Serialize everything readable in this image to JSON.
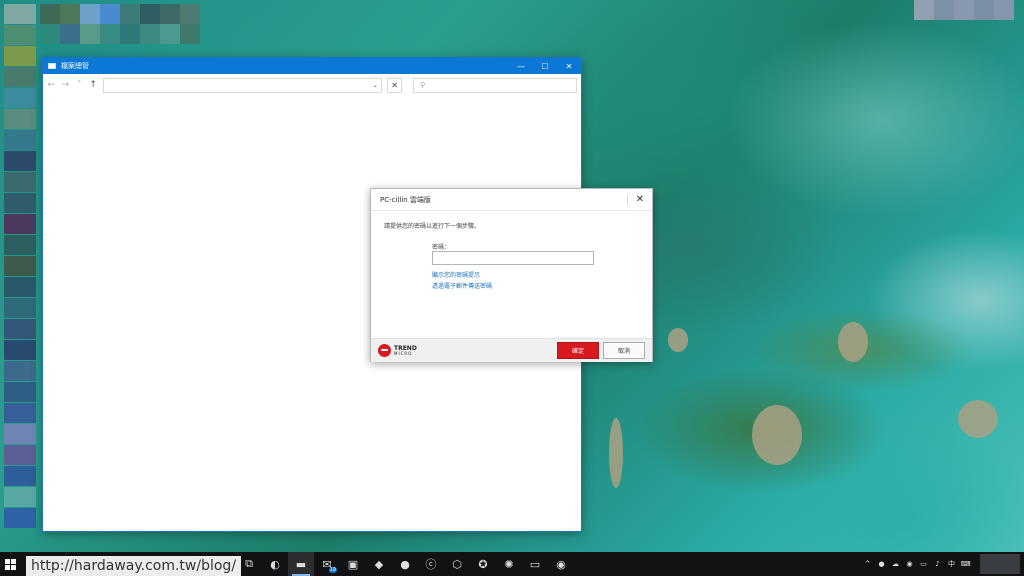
{
  "colors": {
    "accent_blue": "#0a78d4",
    "trend_red": "#d71920",
    "link_blue": "#1a6fbd",
    "taskbar": "#101214"
  },
  "explorer": {
    "title": "檔案總管",
    "controls": {
      "minimize": "—",
      "maximize": "☐",
      "close": "✕"
    },
    "nav": {
      "back": "←",
      "forward": "→",
      "recent": "˅",
      "up": "↑"
    },
    "address_dropdown": "⌄",
    "address_clear": "✕",
    "search_icon": "⚲"
  },
  "dialog": {
    "title": "PC-cillin 雲端版",
    "close": "✕",
    "prompt": "請提供您的密碼以進行下一個步驟。",
    "password_label": "密碼：",
    "password_value": "",
    "link_show_hint": "顯示您的密碼提示",
    "link_email_reset": "透過電子郵件傳送密碼",
    "ok_button": "確定",
    "cancel_button": "取消",
    "logo": {
      "word": "TREND",
      "sub": "MICRO"
    }
  },
  "watermark": "http://hardaway.com.tw/blog/",
  "taskbar": {
    "apps": [
      {
        "name": "task-view-icon",
        "glyph": "⧉"
      },
      {
        "name": "edge-icon",
        "glyph": "◐"
      },
      {
        "name": "file-explorer-icon",
        "glyph": "▬",
        "active": true
      },
      {
        "name": "mail-icon",
        "glyph": "✉",
        "badge": "19"
      },
      {
        "name": "store-icon",
        "glyph": "▣"
      },
      {
        "name": "app-purple-icon",
        "glyph": "◆"
      },
      {
        "name": "firefox-icon",
        "glyph": "●"
      },
      {
        "name": "app-c-icon",
        "glyph": "ⓒ"
      },
      {
        "name": "box-3d-icon",
        "glyph": "⬡"
      },
      {
        "name": "app-yellow-icon",
        "glyph": "✪"
      },
      {
        "name": "app-gear-icon",
        "glyph": "✺"
      },
      {
        "name": "monitor-icon",
        "glyph": "▭"
      },
      {
        "name": "trend-micro-icon",
        "glyph": "◉"
      }
    ],
    "tray": [
      {
        "name": "chevron-up-icon",
        "glyph": "^"
      },
      {
        "name": "tray-app-red-icon",
        "glyph": "●"
      },
      {
        "name": "tray-cloud-icon",
        "glyph": "☁"
      },
      {
        "name": "tray-trend-icon",
        "glyph": "◉"
      },
      {
        "name": "network-icon",
        "glyph": "▭"
      },
      {
        "name": "volume-icon",
        "glyph": "♪"
      },
      {
        "name": "ime-label",
        "glyph": "中"
      },
      {
        "name": "keyboard-icon",
        "glyph": "⌨"
      }
    ],
    "notifications": "▤"
  }
}
